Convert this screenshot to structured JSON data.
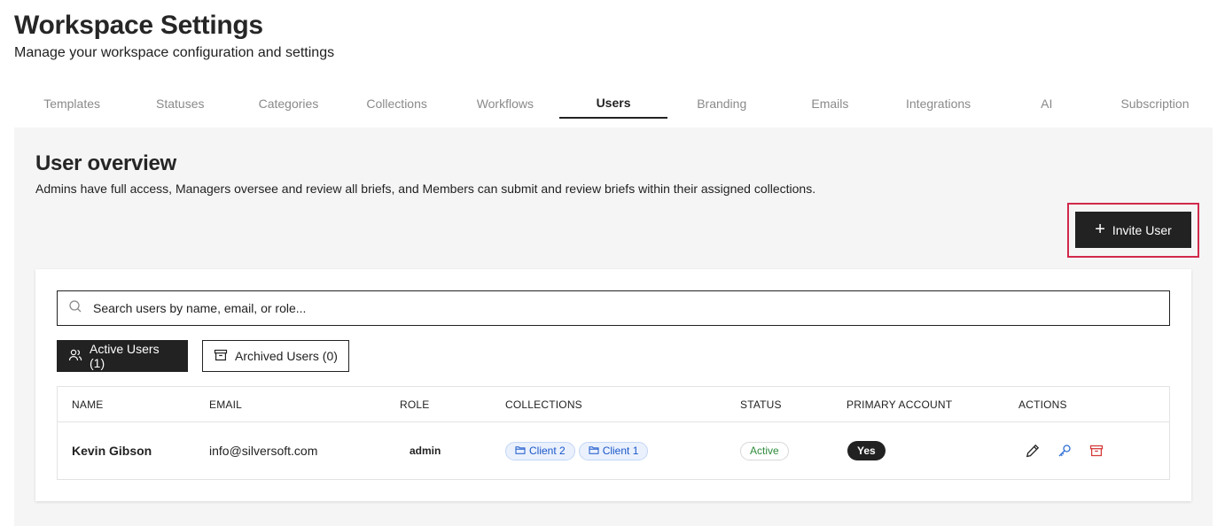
{
  "header": {
    "title": "Workspace Settings",
    "subtitle": "Manage your workspace configuration and settings"
  },
  "tabs": [
    {
      "label": "Templates"
    },
    {
      "label": "Statuses"
    },
    {
      "label": "Categories"
    },
    {
      "label": "Collections"
    },
    {
      "label": "Workflows"
    },
    {
      "label": "Users",
      "active": true
    },
    {
      "label": "Branding"
    },
    {
      "label": "Emails"
    },
    {
      "label": "Integrations"
    },
    {
      "label": "AI"
    },
    {
      "label": "Subscription"
    }
  ],
  "section": {
    "title": "User overview",
    "description": "Admins have full access, Managers oversee and review all briefs, and Members can submit and review briefs within their assigned collections.",
    "invite_label": "Invite User"
  },
  "search": {
    "placeholder": "Search users by name, email, or role..."
  },
  "filters": {
    "active_label": "Active Users (1)",
    "archived_label": "Archived Users (0)"
  },
  "table": {
    "headers": [
      "NAME",
      "EMAIL",
      "ROLE",
      "COLLECTIONS",
      "STATUS",
      "PRIMARY ACCOUNT",
      "ACTIONS"
    ],
    "rows": [
      {
        "name": "Kevin Gibson",
        "email": "info@silversoft.com",
        "role": "admin",
        "collections": [
          "Client 2",
          "Client 1"
        ],
        "status": "Active",
        "primary": "Yes"
      }
    ]
  },
  "icons": {
    "search": "search-icon",
    "users": "users-icon",
    "archive": "archive-icon",
    "folder": "folder-icon",
    "edit": "pencil-icon",
    "key": "key-icon",
    "archive_action": "archive-icon",
    "plus": "plus-icon"
  },
  "colors": {
    "primary": "#222222",
    "highlight": "#d1294b",
    "chip_text": "#1a56c9",
    "status_active": "#2e8b3a",
    "key_icon": "#2f6fd6",
    "archive_icon": "#d63a3a"
  }
}
